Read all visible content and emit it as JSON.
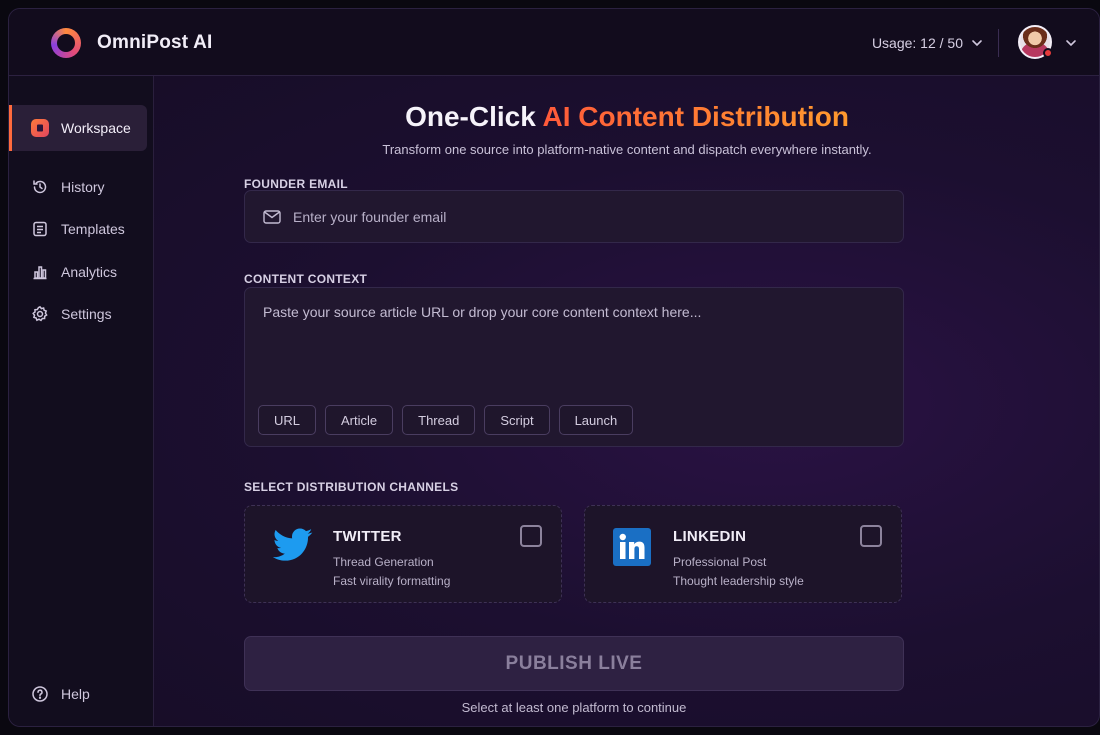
{
  "app": {
    "brand": "OmniPost AI"
  },
  "header": {
    "usage": "Usage: 12 / 50"
  },
  "sidebar": {
    "items": [
      {
        "label": "Workspace",
        "icon": "workspace-icon",
        "active": true
      },
      {
        "label": "History",
        "icon": "history-icon"
      },
      {
        "label": "Templates",
        "icon": "templates-icon"
      },
      {
        "label": "Analytics",
        "icon": "analytics-icon"
      },
      {
        "label": "Settings",
        "icon": "gear-icon"
      }
    ],
    "help": "Help"
  },
  "main": {
    "title_plain": "One-Click ",
    "title_accent": "AI Content Distribution",
    "subtitle": "Transform one source into platform-native content and dispatch everywhere instantly.",
    "email": {
      "label": "FOUNDER EMAIL",
      "placeholder": "Enter your founder email",
      "value": ""
    },
    "context": {
      "label": "CONTENT CONTEXT",
      "placeholder": "Paste your source article URL or drop your core content context here...",
      "value": "",
      "chips": [
        "URL",
        "Article",
        "Thread",
        "Script",
        "Launch"
      ]
    },
    "channels_label": "SELECT DISTRIBUTION CHANNELS",
    "channels": [
      {
        "name": "TWITTER",
        "line1": "Thread Generation",
        "line2": "Fast virality formatting",
        "checked": false,
        "icon": "twitter-icon"
      },
      {
        "name": "LINKEDIN",
        "line1": "Professional Post",
        "line2": "Thought leadership style",
        "checked": false,
        "icon": "linkedin-icon"
      }
    ],
    "publish_label": "PUBLISH LIVE",
    "hint": "Select at least one platform to continue"
  },
  "colors": {
    "accent_start": "#ff5a3a",
    "accent_end": "#ff9a2e",
    "twitter": "#1d9bf0",
    "linkedin": "#0a66c2"
  }
}
